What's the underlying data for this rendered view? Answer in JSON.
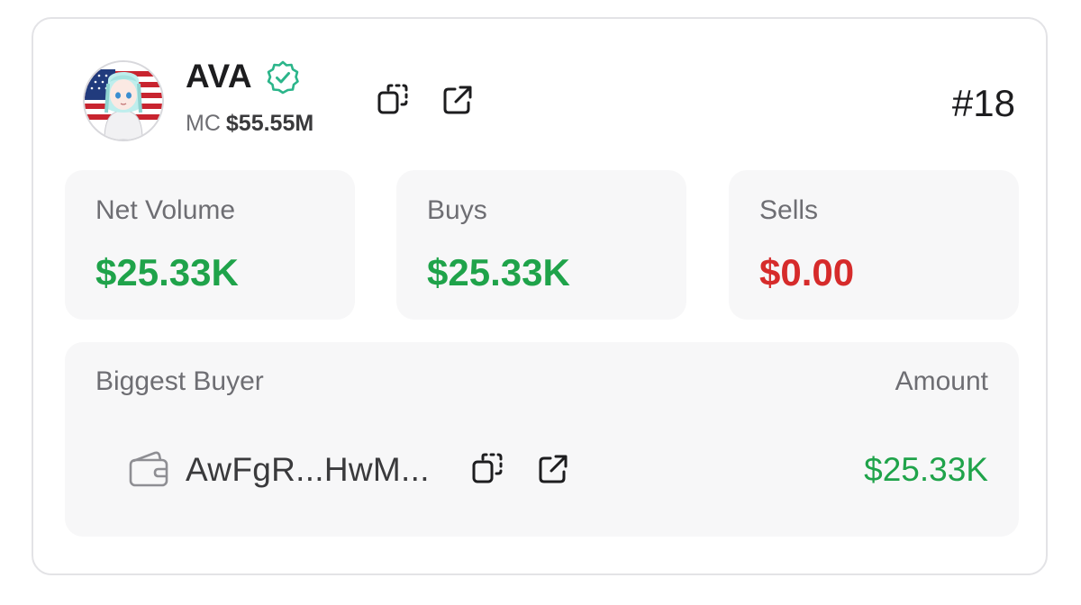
{
  "token": {
    "name": "AVA",
    "mc_label": "MC",
    "mc_value": "$55.55M",
    "rank": "#18",
    "avatar_icon": "token-avatar-anime-flag",
    "verified_icon": "verified-badge-icon",
    "actions": {
      "copy_icon": "copy-icon",
      "external_icon": "external-link-icon"
    }
  },
  "stats": [
    {
      "label": "Net Volume",
      "value": "$25.33K",
      "tone": "positive"
    },
    {
      "label": "Buys",
      "value": "$25.33K",
      "tone": "positive"
    },
    {
      "label": "Sells",
      "value": "$0.00",
      "tone": "negative"
    }
  ],
  "biggest_buyer": {
    "label": "Biggest Buyer",
    "amount_label": "Amount",
    "wallet_icon": "wallet-icon",
    "address": "AwFgR...HwM...",
    "amount": "$25.33K"
  },
  "colors": {
    "positive": "#1fa34a",
    "negative": "#d62b2b",
    "verified": "#2bb58a",
    "panel_bg": "#f7f7f8",
    "border": "#e3e3e6"
  }
}
